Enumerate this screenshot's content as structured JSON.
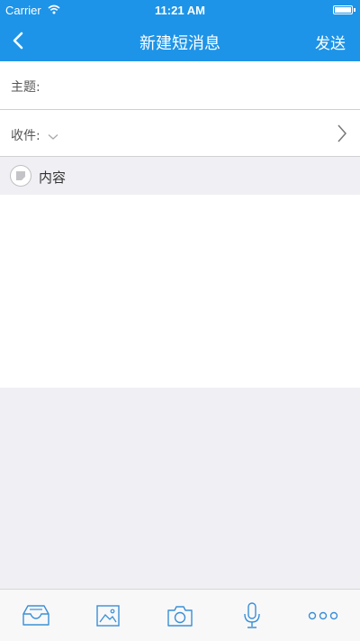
{
  "status_bar": {
    "carrier": "Carrier",
    "time": "11:21 AM"
  },
  "nav": {
    "title": "新建短消息",
    "send_label": "发送"
  },
  "form": {
    "subject_label": "主题:",
    "subject_value": "",
    "recipient_label": "收件:",
    "content_label": "内容",
    "content_value": ""
  },
  "toolbar": {
    "items": [
      "inbox-tray-icon",
      "image-icon",
      "camera-icon",
      "microphone-icon",
      "more-icon"
    ]
  },
  "colors": {
    "header_bg": "#1d94e8",
    "icon_blue": "#3a8fd6",
    "page_bg": "#efeff4"
  }
}
